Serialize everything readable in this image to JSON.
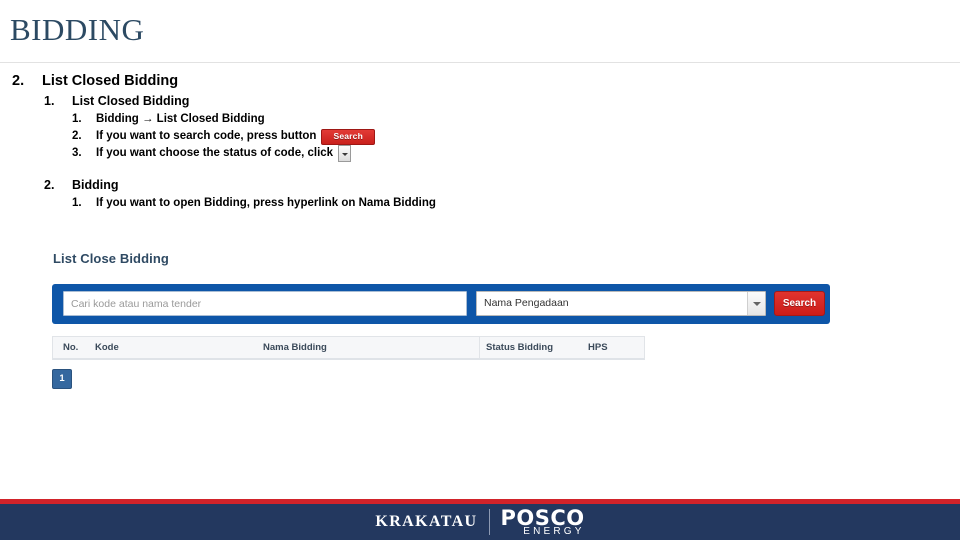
{
  "slide": {
    "title": "BIDDING"
  },
  "outline": {
    "section": {
      "num": "2.",
      "label": "List Closed Bidding"
    },
    "sub1": {
      "num": "1.",
      "label": "List Closed Bidding",
      "steps": [
        {
          "num": "1.",
          "text": "Bidding → List Closed Bidding"
        },
        {
          "num": "2.",
          "text": "If you want to search code, press button",
          "widget": "search-button",
          "widget_label": "Search"
        },
        {
          "num": "3.",
          "text": "If you want choose the status of code, click",
          "widget": "dropdown-button"
        }
      ]
    },
    "sub2": {
      "num": "2.",
      "label": "Bidding",
      "steps": [
        {
          "num": "1.",
          "text": "If you want to open Bidding, press hyperlink on Nama Bidding"
        }
      ]
    }
  },
  "app": {
    "panel_heading": "List Close Bidding",
    "search": {
      "input_value": "",
      "input_placeholder": "Cari kode atau nama tender",
      "select_value": "Nama Pengadaan",
      "select_options": [
        "Nama Pengadaan"
      ],
      "button_label": "Search"
    },
    "table": {
      "columns": [
        "No.",
        "Kode",
        "Nama Bidding",
        "Status Bidding",
        "HPS"
      ],
      "rows": []
    },
    "pagination": {
      "current_page": "1"
    }
  },
  "footer": {
    "brand_left": "KRAKATAU",
    "brand_right": "POSCO",
    "brand_right_sub": "ENERGY"
  },
  "colors": {
    "title_blue": "#2c4a63",
    "panel_blue": "#0e56a8",
    "accent_red": "#cc1d19",
    "footer_navy": "#23385f",
    "footer_red": "#d1232a",
    "pagination_blue": "#35689f"
  }
}
